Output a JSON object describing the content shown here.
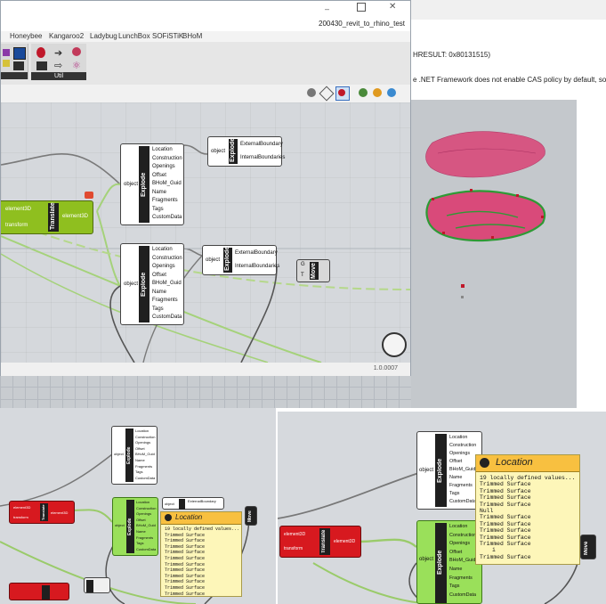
{
  "window": {
    "title": "200430_revit_to_rhino_test",
    "version": "1.0.0007"
  },
  "menu": [
    "Honeybee",
    "Kangaroo2",
    "Ladybug",
    "LunchBox",
    "SOFiSTiK",
    "BHoM"
  ],
  "ribbon": {
    "group_util": "Util"
  },
  "command_line": [
    "HRESULT: 0x80131515)",
    "e .NET Framework does not enable CAS policy by default, so t"
  ],
  "components": {
    "translate": {
      "name": "Translate",
      "inputs": [
        "element3D",
        "transform"
      ],
      "outputs": [
        "element3D"
      ]
    },
    "explode": {
      "name": "Explode",
      "input": "object",
      "outputs": [
        "Location",
        "Construction",
        "Openings",
        "Offset",
        "BHoM_Guid",
        "Name",
        "Fragments",
        "Tags",
        "CustomData"
      ]
    },
    "explode_small": {
      "name": "Explode",
      "input": "object",
      "outputs": [
        "ExternalBoundary",
        "InternalBoundaries"
      ]
    },
    "move": {
      "name": "Move",
      "inputs": [
        "G",
        "T"
      ]
    }
  },
  "tooltip": {
    "title": "Location",
    "lines_small": [
      "19 locally defined values...",
      "Trimmed Surface",
      "Trimmed Surface",
      "Trimmed Surface",
      "Trimmed Surface",
      "Trimmed Surface",
      "Trimmed Surface",
      "Trimmed Surface",
      "Trimmed Surface",
      "Trimmed Surface",
      "Trimmed Surface",
      "Trimmed Surface"
    ],
    "lines_large": [
      "19 locally defined values...",
      "Trimmed Surface",
      "Trimmed Surface",
      "Trimmed Surface",
      "Trimmed Surface",
      "Null",
      "Trimmed Surface",
      "Trimmed Surface",
      "Trimmed Surface",
      "Trimmed Surface",
      "Trimmed Surface",
      "i",
      "Trimmed Surface"
    ]
  },
  "colors": {
    "translate_green": "#8fbf1f",
    "error_red": "#d7191f",
    "selected_lime": "#9ae05a",
    "tooltip_yellow": "#fdf6b9",
    "tooltip_header": "#f8c040",
    "geometry_pink": "#d94a7a",
    "geometry_green": "#2e9a35"
  },
  "icons": [
    "minimize-icon",
    "maximize-icon",
    "search-icon",
    "shade-icon",
    "sphere-icon",
    "close-icon"
  ]
}
